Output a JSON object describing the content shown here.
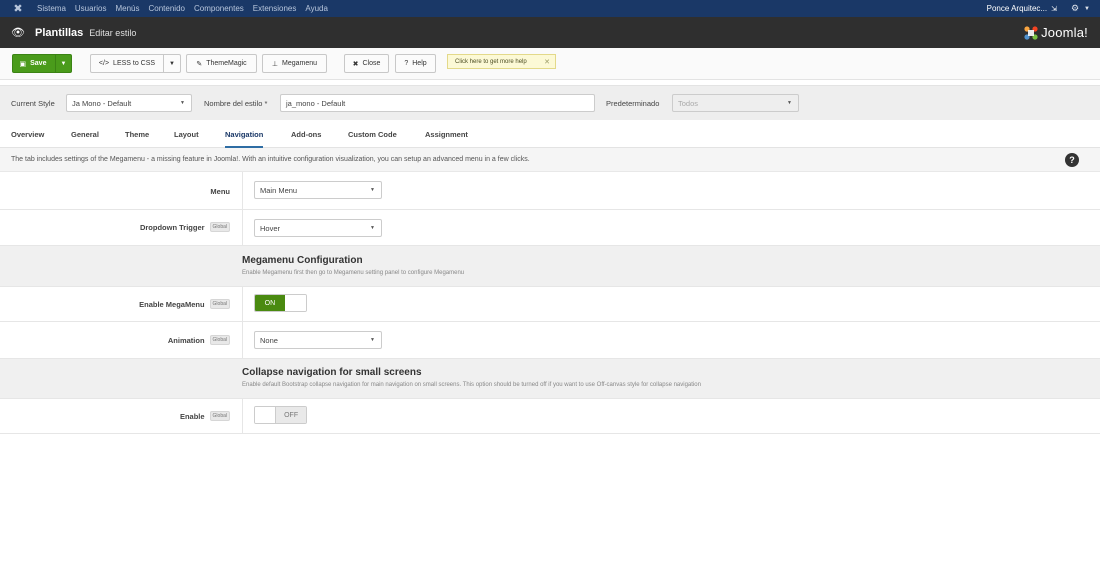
{
  "topnav": {
    "items": [
      "Sistema",
      "Usuarios",
      "Menús",
      "Contenido",
      "Componentes",
      "Extensiones",
      "Ayuda"
    ],
    "user": "Ponce Arquitec...",
    "ext_icon": "external-link-icon",
    "gear_icon": "gear-icon"
  },
  "header": {
    "title": "Plantillas",
    "subtitle": "Editar estilo",
    "logo": "Joomla!"
  },
  "toolbar": {
    "save": "Save",
    "less_to_css": "LESS to CSS",
    "thememagic": "ThemeMagic",
    "megamenu": "Megamenu",
    "close": "Close",
    "help": "Help",
    "tip": "Click here to get more help"
  },
  "stylebar": {
    "current_style_label": "Current Style",
    "current_style_value": "Ja Mono - Default",
    "style_name_label": "Nombre del estilo *",
    "style_name_value": "ja_mono - Default",
    "default_label": "Predeterminado",
    "default_value": "Todos"
  },
  "tabs": [
    {
      "label": "Overview",
      "active": false
    },
    {
      "label": "General",
      "active": false
    },
    {
      "label": "Theme",
      "active": false
    },
    {
      "label": "Layout",
      "active": false
    },
    {
      "label": "Navigation",
      "active": true
    },
    {
      "label": "Add-ons",
      "active": false
    },
    {
      "label": "Custom Code",
      "active": false
    },
    {
      "label": "Assignment",
      "active": false
    }
  ],
  "description": "The tab includes settings of the Megamenu - a missing feature in Joomla!. With an intuitive configuration visualization, you can setup an advanced menu in a few clicks.",
  "form": {
    "menu_label": "Menu",
    "menu_value": "Main Menu",
    "dropdown_trigger_label": "Dropdown Trigger",
    "dropdown_trigger_value": "Hover",
    "global_badge": "Global",
    "megamenu_section_title": "Megamenu Configuration",
    "megamenu_section_desc": "Enable Megamenu first then go to Megamenu setting panel to configure Megamenu",
    "enable_megamenu_label": "Enable MegaMenu",
    "enable_megamenu_state": "ON",
    "animation_label": "Animation",
    "animation_value": "None",
    "collapse_section_title": "Collapse navigation for small screens",
    "collapse_section_desc": "Enable default Bootstrap collapse navigation for main navigation on small screens. This option should be turned off if you want to use Off-canvas style for collapse navigation",
    "enable_label": "Enable",
    "enable_state": "OFF"
  },
  "colors": {
    "topnav_bg": "#1a3867",
    "header_bg": "#2f2f2f",
    "save_green": "#4a9b1b",
    "toggle_on": "#4a8a10"
  }
}
